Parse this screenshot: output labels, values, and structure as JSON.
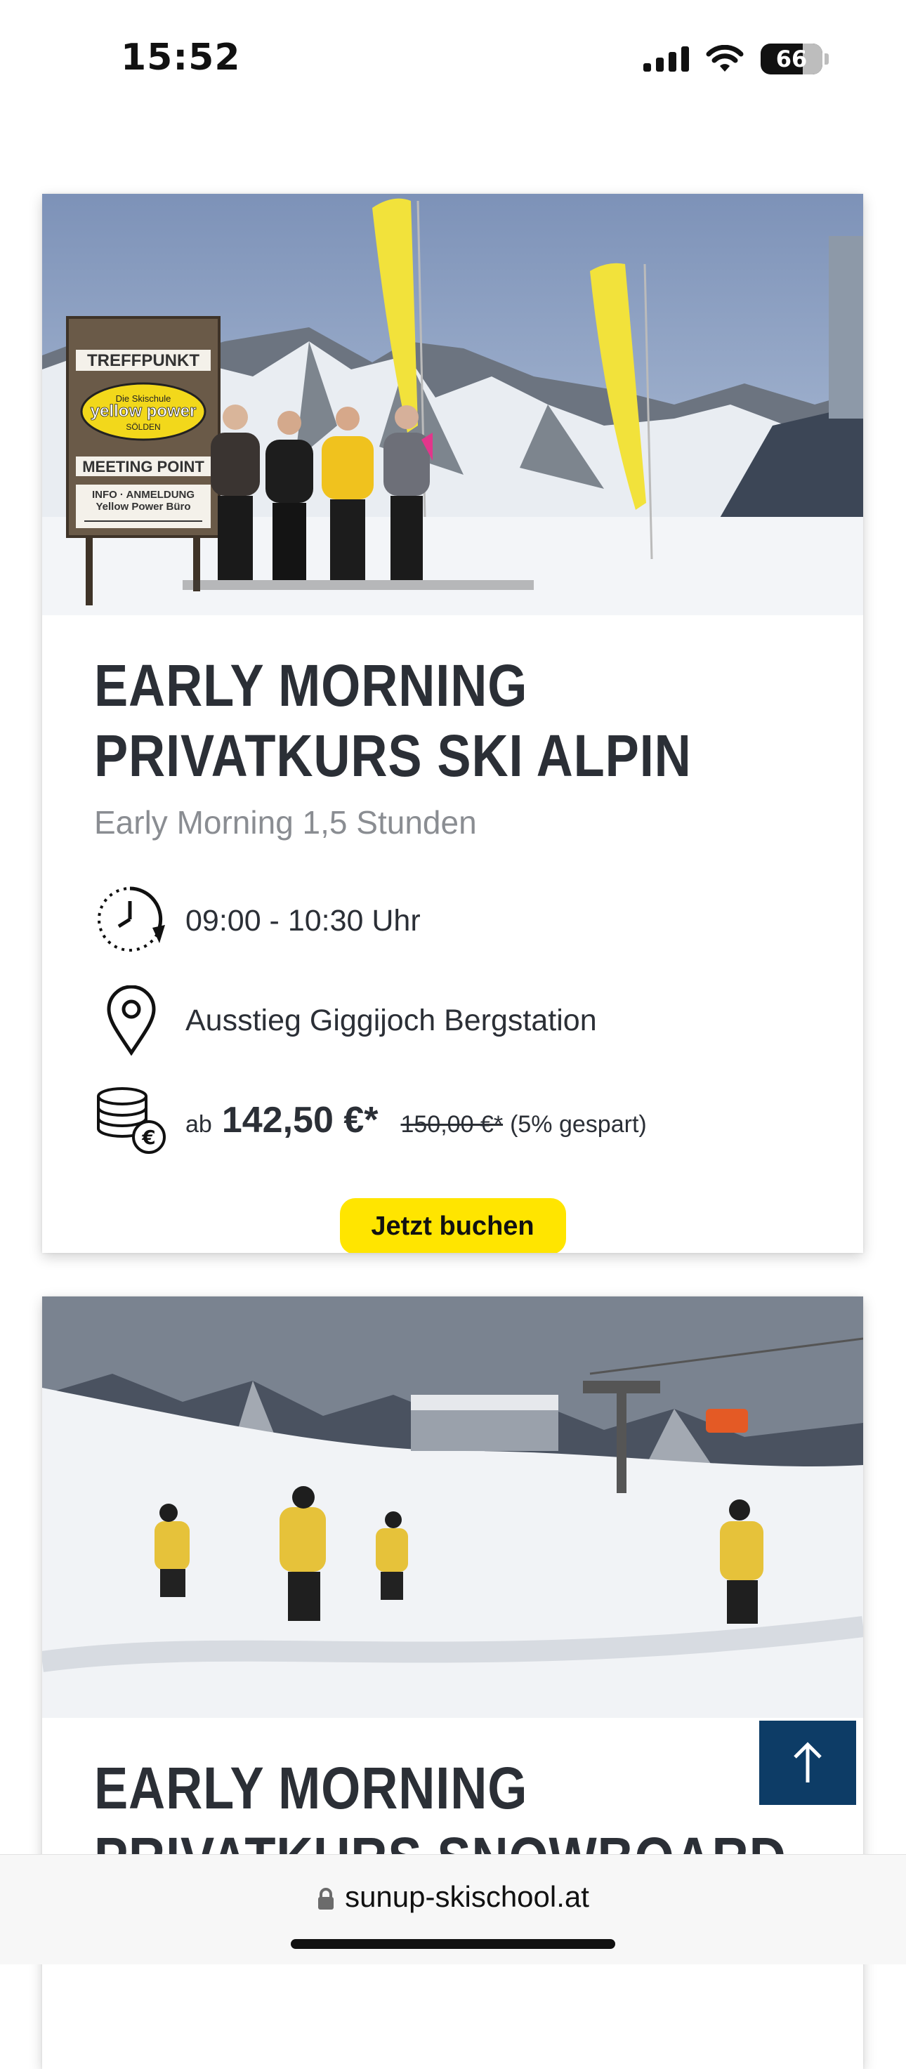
{
  "status_bar": {
    "time": "15:52",
    "battery": "66"
  },
  "courses": [
    {
      "title": "EARLY MORNING PRIVATKURS SKI ALPIN",
      "subtitle": "Early Morning 1,5 Stunden",
      "time": "09:00 - 10:30 Uhr",
      "location": "Ausstieg Giggijoch Bergstation",
      "price_prefix": "ab",
      "price": "142,50 €*",
      "old_price": "150,00 €*",
      "saving": "(5% gespart)",
      "button": "Jetzt buchen",
      "image": {
        "sign_top": "TREFFPUNKT",
        "sign_brand_small": "Die Skischule",
        "sign_brand": "yellow power",
        "sign_brand_sub": "SÖLDEN",
        "sign_meeting": "MEETING POINT",
        "sign_info_1": "INFO · ANMELDUNG",
        "sign_info_2": "Yellow Power Büro"
      }
    },
    {
      "title": "EARLY MORNING PRIVATKURS SNOWBOARD"
    }
  ],
  "browser": {
    "url": "sunup-skischool.at"
  },
  "colors": {
    "accent_yellow": "#ffe500",
    "navy": "#0d3c66",
    "text": "#2b2f36",
    "muted": "#8a8d92"
  }
}
